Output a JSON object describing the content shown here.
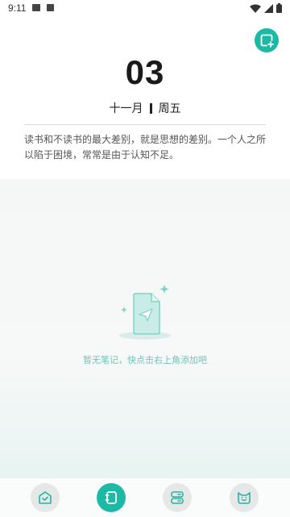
{
  "status_bar": {
    "time": "9:11"
  },
  "header": {
    "day": "03",
    "month": "十一月",
    "weekday": "周五"
  },
  "quote": "读书和不读书的最大差别，就是思想的差别。一个人之所以陷于困境，常常是由于认知不足。",
  "empty_state": {
    "message": "暂无笔记，快点击右上角添加吧"
  },
  "colors": {
    "accent": "#1cb9a4",
    "empty_text": "#6fc4b6"
  },
  "bottom_nav": {
    "items": [
      {
        "icon": "home-icon",
        "active": false
      },
      {
        "icon": "notebook-icon",
        "active": true
      },
      {
        "icon": "list-icon",
        "active": false
      },
      {
        "icon": "cat-icon",
        "active": false
      }
    ]
  }
}
